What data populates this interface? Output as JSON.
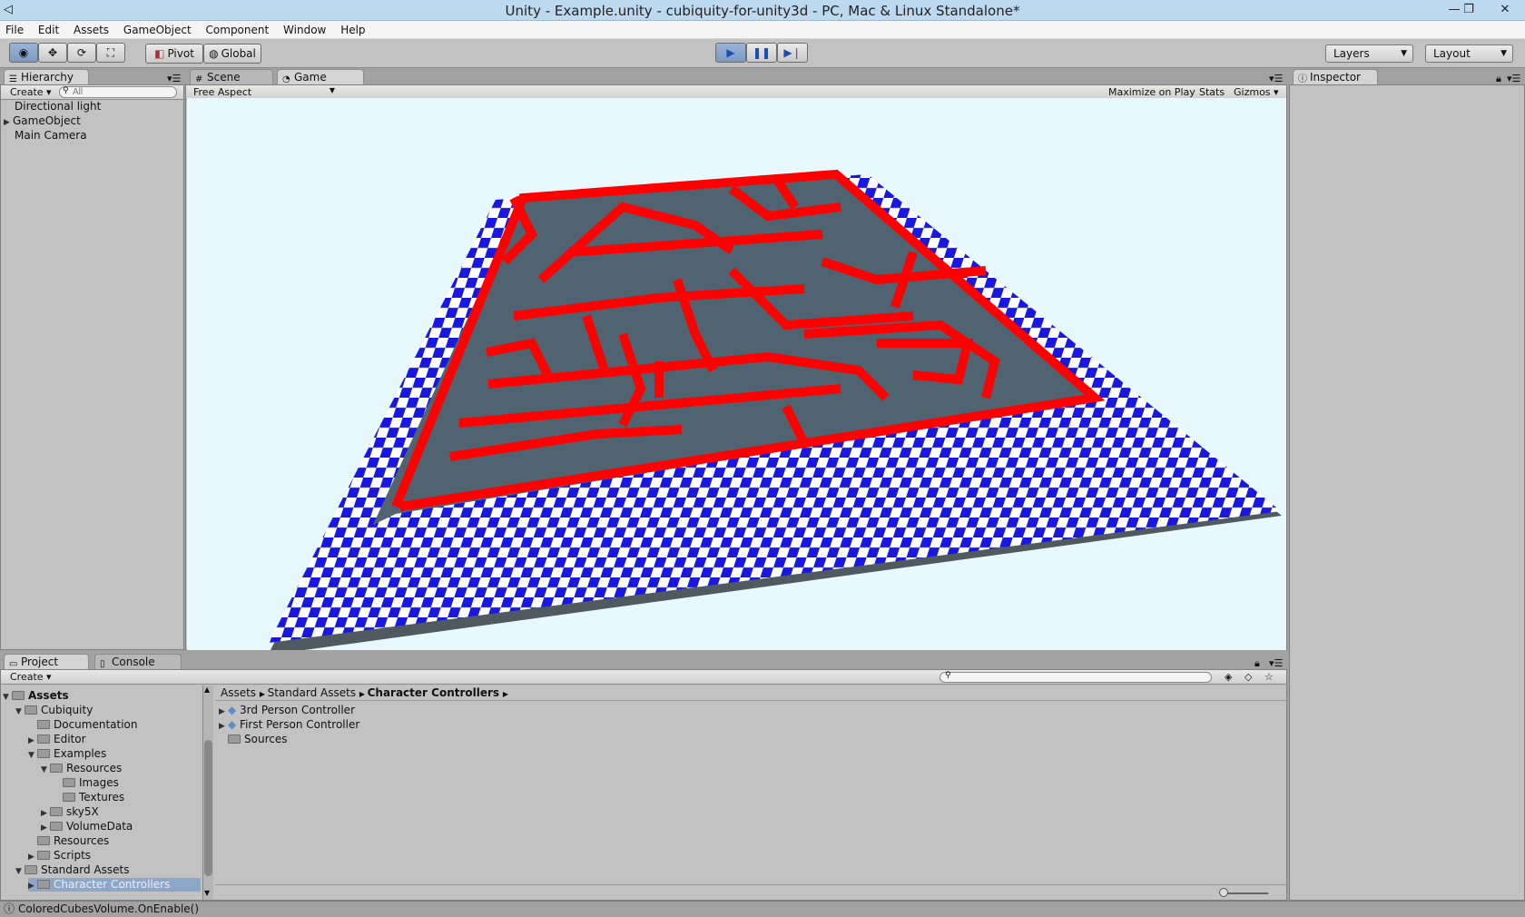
{
  "window": {
    "title": "Unity - Example.unity - cubiquity-for-unity3d - PC, Mac & Linux Standalone*"
  },
  "menu": [
    "File",
    "Edit",
    "Assets",
    "GameObject",
    "Component",
    "Window",
    "Help"
  ],
  "toolbar": {
    "pivot_label": "Pivot",
    "global_label": "Global",
    "layers_label": "Layers",
    "layout_label": "Layout"
  },
  "hierarchy": {
    "tab_label": "Hierarchy",
    "create_label": "Create",
    "search_placeholder": "All",
    "items": [
      "Directional light",
      "GameObject",
      "Main Camera"
    ]
  },
  "scene_tab": {
    "label": "Scene"
  },
  "game_tab": {
    "label": "Game",
    "aspect": "Free Aspect",
    "maximize": "Maximize on Play",
    "stats": "Stats",
    "gizmos": "Gizmos"
  },
  "inspector": {
    "tab_label": "Inspector"
  },
  "project": {
    "tab_label": "Project",
    "console_label": "Console",
    "create_label": "Create",
    "tree": [
      "Assets",
      "Cubiquity",
      "Documentation",
      "Editor",
      "Examples",
      "Resources",
      "Images",
      "Textures",
      "sky5X",
      "VolumeData",
      "Resources",
      "Scripts",
      "Standard Assets",
      "Character Controllers"
    ],
    "breadcrumb": [
      "Assets",
      "Standard Assets",
      "Character Controllers"
    ],
    "files": [
      "3rd Person Controller",
      "First Person Controller",
      "Sources"
    ]
  },
  "status": {
    "message": "ColoredCubesVolume.OnEnable()"
  },
  "colors": {
    "wall_top": "#ff0000",
    "wall_side": "#4f6470",
    "checker_a": "#1818e0",
    "checker_b": "#ffffff",
    "sky": "#e8f8ff"
  }
}
